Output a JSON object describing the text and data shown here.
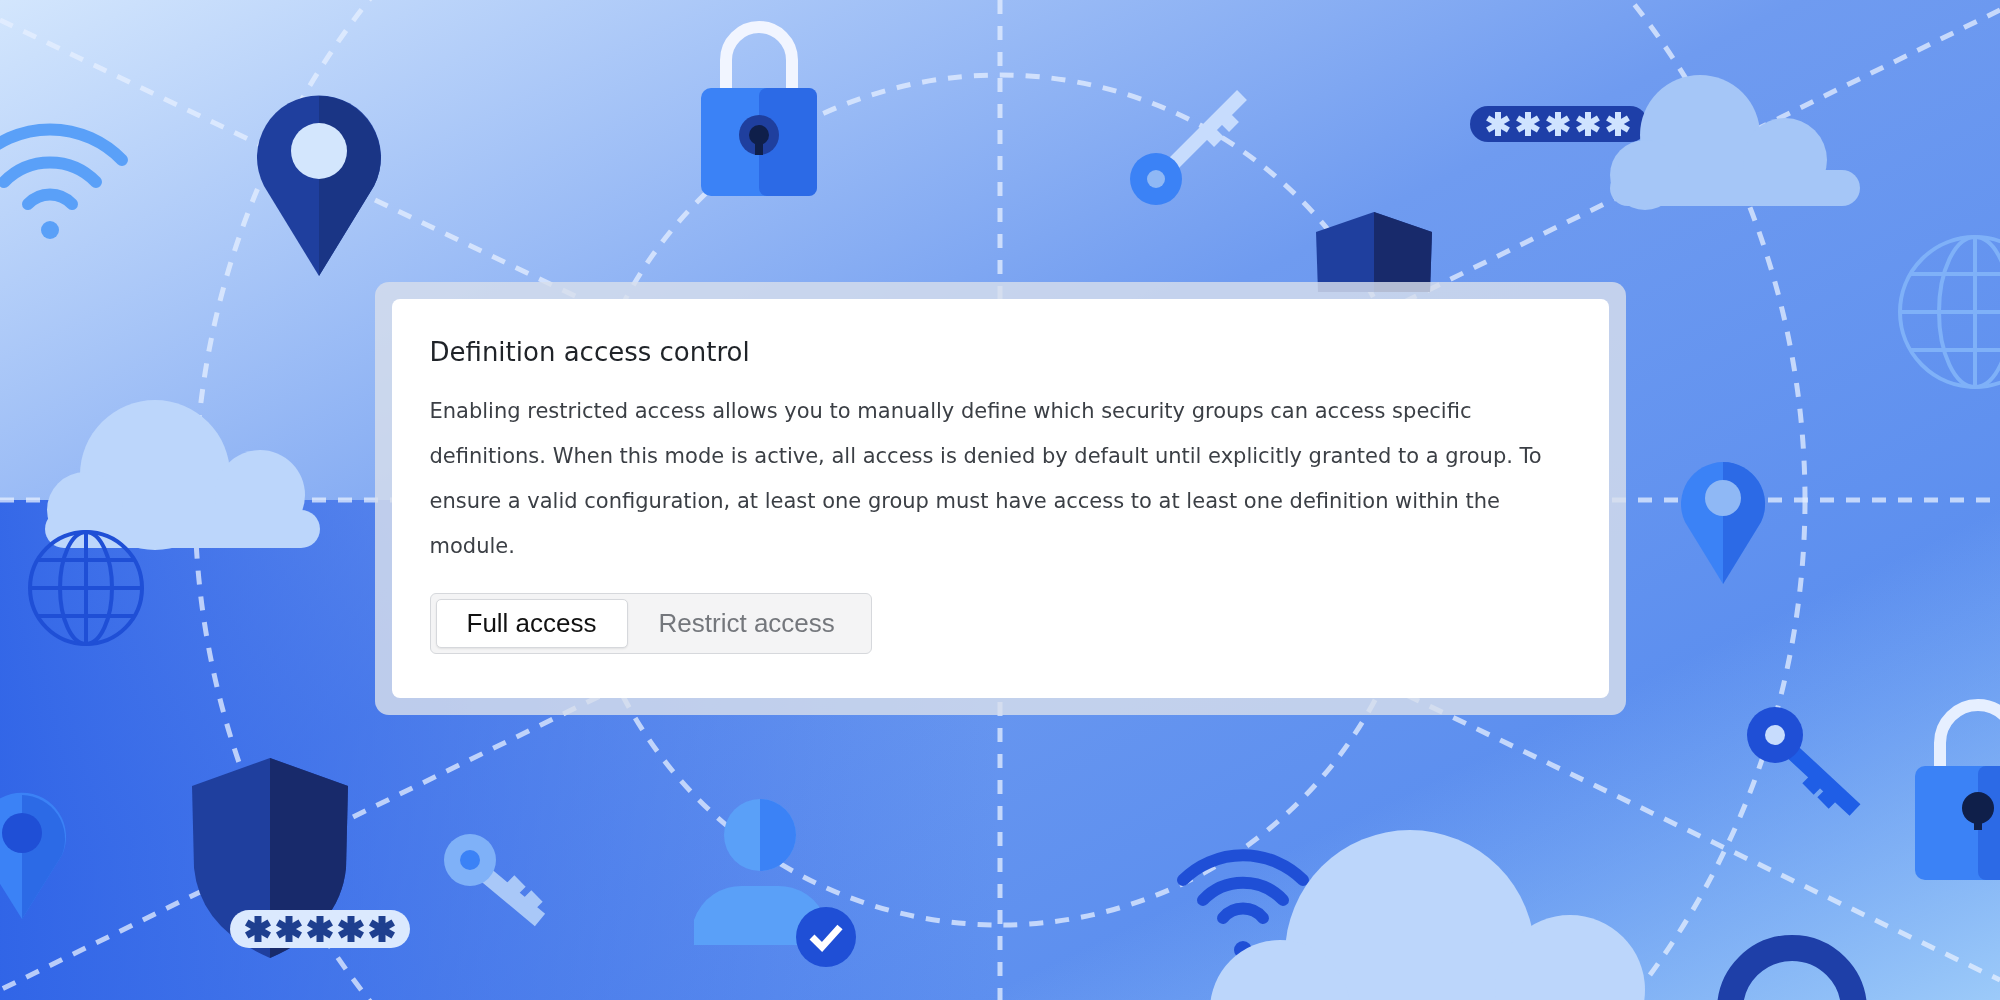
{
  "card": {
    "title": "Definition access control",
    "description": "Enabling restricted access allows you to manually define which security groups can access specific definitions. When this mode is active, all access is denied by default until explicitly granted to a group. To ensure a valid configuration, at least one group must have access to at least one definition within the module.",
    "access_modes": [
      {
        "label": "Full access",
        "selected": true
      },
      {
        "label": "Restrict access",
        "selected": false
      }
    ]
  }
}
